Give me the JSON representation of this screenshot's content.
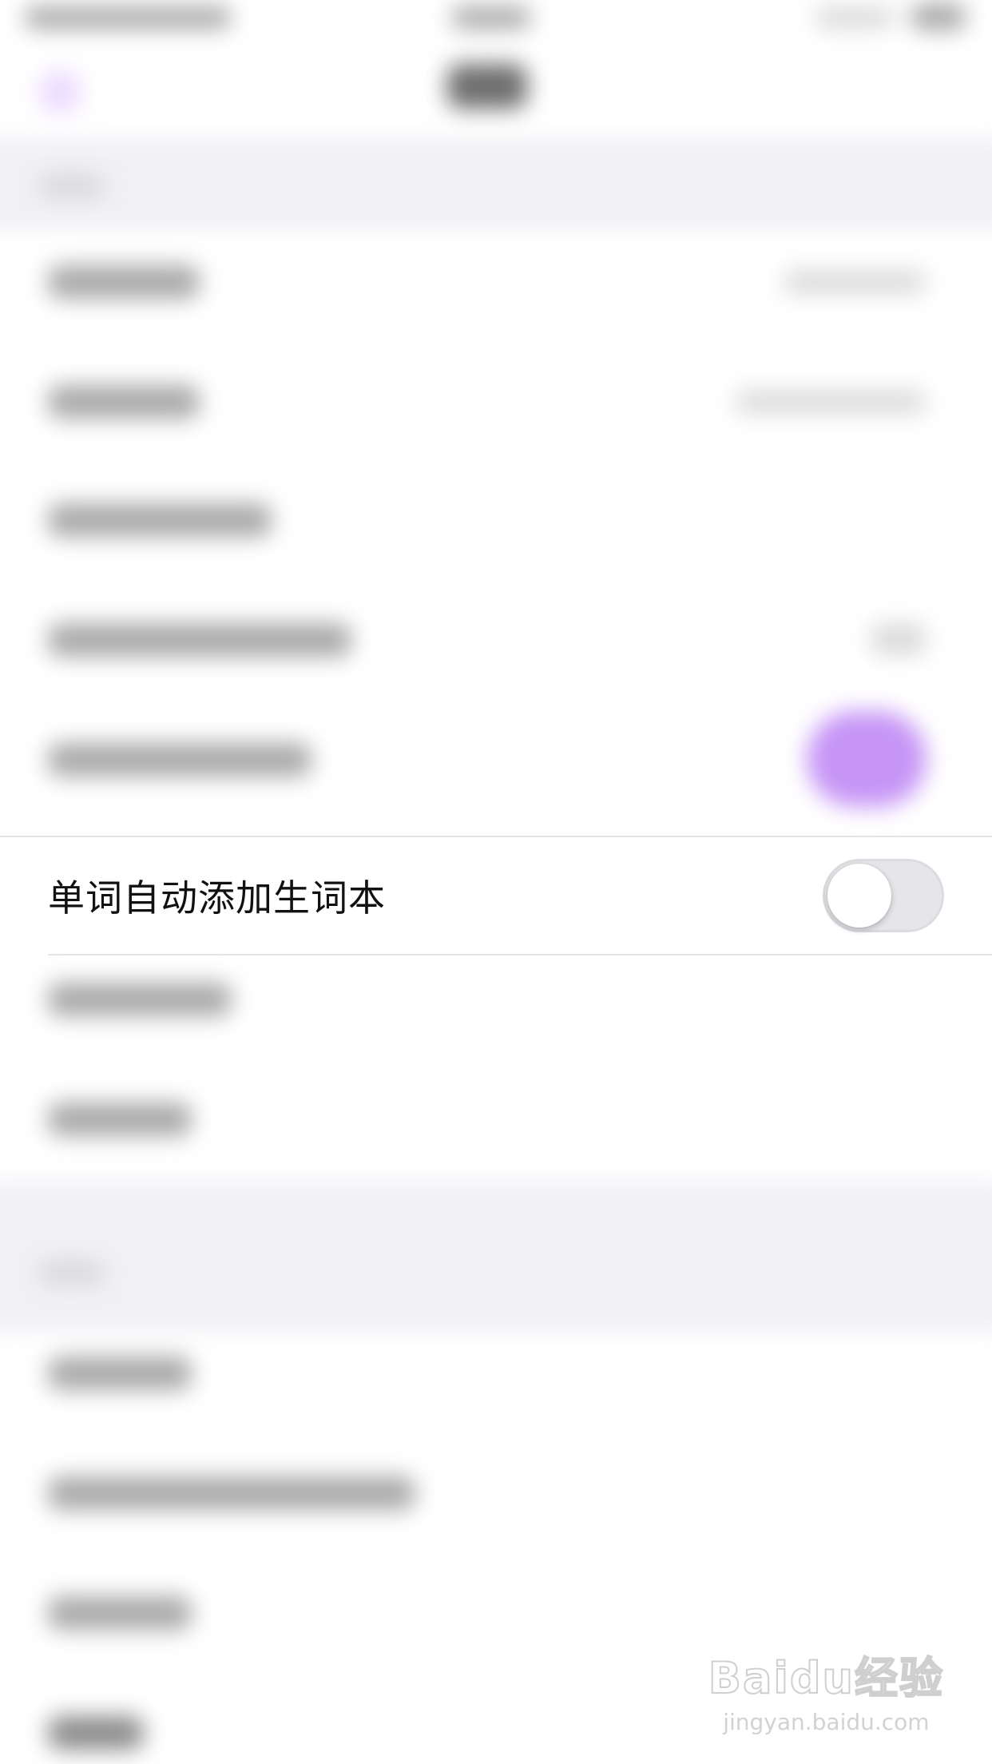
{
  "settings": {
    "focused_item": {
      "label": "单词自动添加生词本",
      "toggle_on": false
    }
  },
  "watermark": {
    "brand": "Baidu经验",
    "site": "jingyan.baidu.com"
  },
  "colors": {
    "accent": "#c08af5",
    "toggle_off_track": "#e5e5ea",
    "section_background": "#f0f0f5"
  }
}
